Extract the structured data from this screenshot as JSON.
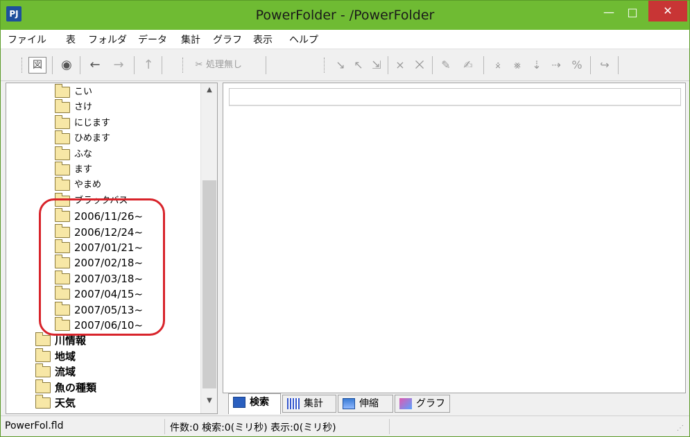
{
  "window": {
    "title": "PowerFolder - /PowerFolder",
    "logo": "PJ"
  },
  "menubar": {
    "items": [
      "ファイル",
      "表",
      "フォルダ",
      "データ",
      "集計",
      "グラフ",
      "表示",
      "ヘルプ"
    ]
  },
  "toolbar": {
    "no_process_label": "処理無し"
  },
  "tree": {
    "items": [
      {
        "label": "こい",
        "bold": false
      },
      {
        "label": "さけ",
        "bold": false
      },
      {
        "label": "にじます",
        "bold": false
      },
      {
        "label": "ひめます",
        "bold": false
      },
      {
        "label": "ふな",
        "bold": false
      },
      {
        "label": "ます",
        "bold": false
      },
      {
        "label": "やまめ",
        "bold": false
      },
      {
        "label": "ブラックバス",
        "bold": false
      },
      {
        "label": "2006/11/26~",
        "bold": false
      },
      {
        "label": "2006/12/24~",
        "bold": false
      },
      {
        "label": "2007/01/21~",
        "bold": false
      },
      {
        "label": "2007/02/18~",
        "bold": false
      },
      {
        "label": "2007/03/18~",
        "bold": false
      },
      {
        "label": "2007/04/15~",
        "bold": false
      },
      {
        "label": "2007/05/13~",
        "bold": false
      },
      {
        "label": "2007/06/10~",
        "bold": false
      },
      {
        "label": "川情報",
        "bold": true
      },
      {
        "label": "地域",
        "bold": true
      },
      {
        "label": "流域",
        "bold": true
      },
      {
        "label": "魚の種類",
        "bold": true
      },
      {
        "label": "天気",
        "bold": true
      }
    ]
  },
  "tabs": [
    {
      "label": "検索",
      "active": true,
      "icon": "search-tab-icon"
    },
    {
      "label": "集計",
      "active": false,
      "icon": "grid-tab-icon"
    },
    {
      "label": "伸縮",
      "active": false,
      "icon": "stretch-tab-icon"
    },
    {
      "label": "グラフ",
      "active": false,
      "icon": "graph-tab-icon"
    }
  ],
  "status": {
    "file": "PowerFol.fld",
    "info": "件数:0 検索:0(ミリ秒) 表示:0(ミリ秒)"
  },
  "colors": {
    "titlebar": "#6fbb33",
    "close": "#c83535",
    "highlight": "#d8232a"
  }
}
